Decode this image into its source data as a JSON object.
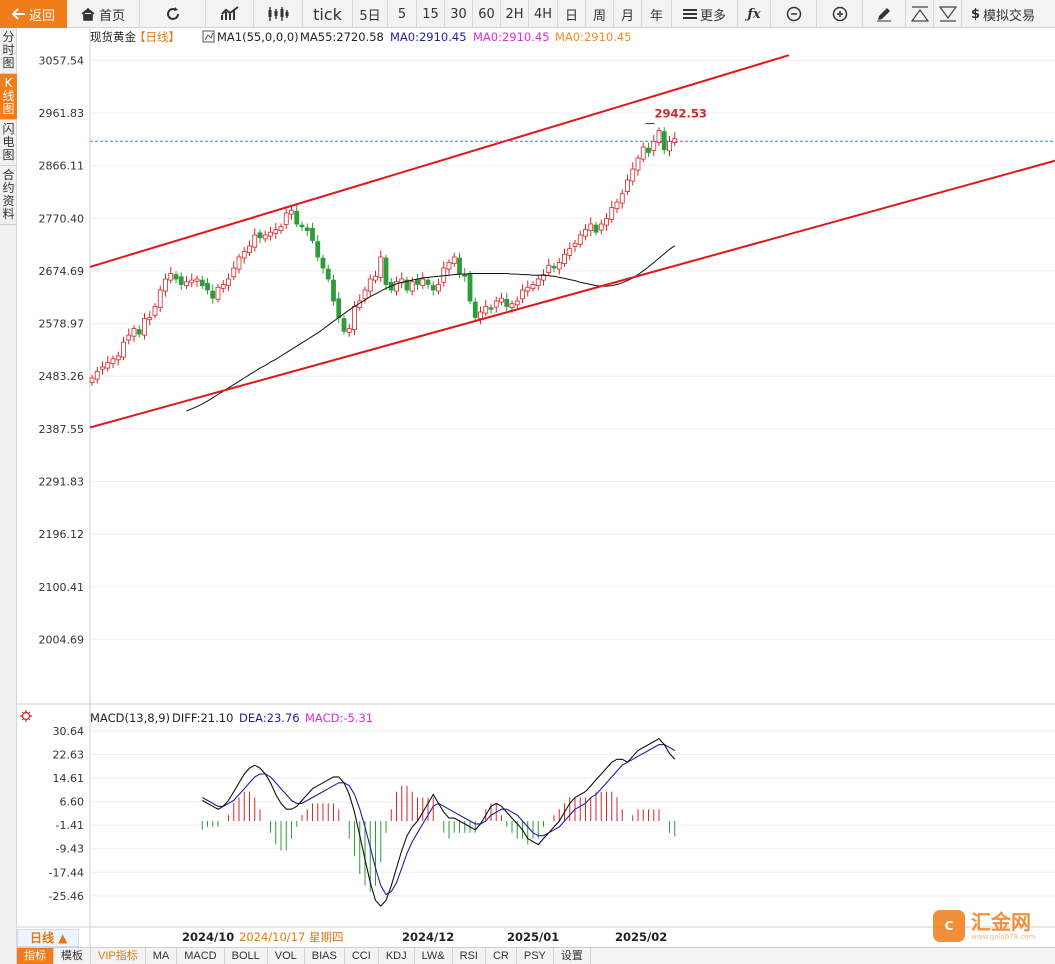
{
  "toolbar": {
    "back": "返回",
    "home": "首页",
    "tick": "tick",
    "periods": [
      "5日",
      "5",
      "15",
      "30",
      "60",
      "2H",
      "4H",
      "日",
      "周",
      "月",
      "年"
    ],
    "more": "更多",
    "simulate": "模拟交易"
  },
  "left_tabs": [
    {
      "label": "分时图",
      "active": false
    },
    {
      "label": "K线图",
      "active": true
    },
    {
      "label": "闪电图",
      "active": false
    },
    {
      "label": "合约资料",
      "active": false
    }
  ],
  "legend": {
    "symbol": "现货黄金",
    "period_tag": "【日线】",
    "ma1": "MA1(55,0,0,0)",
    "ma55": "MA55:2720.58",
    "ma_a": "MA0:2910.45",
    "ma_b": "MA0:2910.45",
    "ma_c": "MA0:2910.45",
    "high_label": "2942.53"
  },
  "macd_legend": {
    "name": "MACD(13,8,9)",
    "diff": "DIFF:21.10",
    "dea": "DEA:23.76",
    "macd": "MACD:-5.31"
  },
  "x_labels": [
    {
      "text": "2024/10",
      "highlight": false
    },
    {
      "text": "2024/10/17 星期四",
      "highlight": true
    },
    {
      "text": "2024/12",
      "highlight": false
    },
    {
      "text": "2025/01",
      "highlight": false
    },
    {
      "text": "2025/02",
      "highlight": false
    }
  ],
  "period_tab": "日线 ▲",
  "bottom_tabs": [
    "指标",
    "模板",
    "VIP指标",
    "MA",
    "MACD",
    "BOLL",
    "VOL",
    "BIAS",
    "CCI",
    "KDJ",
    "LW&",
    "RSI",
    "CR",
    "PSY",
    "设置"
  ],
  "watermark": {
    "name": "汇金网",
    "url": "www.gold678.com"
  },
  "colors": {
    "accent": "#f07c1a",
    "up": "#d62728",
    "down": "#2e9c3a",
    "channel": "#e0161b",
    "dif": "#111111",
    "dea": "#1f1f9f",
    "ma": "#111111"
  },
  "chart_data": [
    {
      "type": "candlestick",
      "title": "现货黄金 【日线】",
      "ylim": [
        1960,
        3080
      ],
      "y_ticks": [
        "3057.54",
        "2961.83",
        "2866.11",
        "2770.40",
        "2674.69",
        "2578.97",
        "2483.26",
        "2387.55",
        "2291.83",
        "2196.12",
        "2100.41",
        "2004.69"
      ],
      "last_price_line": 2910.45,
      "high_marker": 2942.53,
      "close": [
        2480,
        2492,
        2500,
        2508,
        2515,
        2520,
        2545,
        2558,
        2570,
        2560,
        2588,
        2590,
        2610,
        2640,
        2660,
        2670,
        2660,
        2650,
        2655,
        2658,
        2660,
        2648,
        2640,
        2625,
        2645,
        2650,
        2660,
        2680,
        2700,
        2710,
        2720,
        2740,
        2735,
        2740,
        2745,
        2750,
        2755,
        2780,
        2785,
        2760,
        2755,
        2748,
        2730,
        2700,
        2680,
        2660,
        2620,
        2590,
        2565,
        2570,
        2610,
        2620,
        2640,
        2660,
        2665,
        2700,
        2650,
        2640,
        2655,
        2660,
        2640,
        2655,
        2650,
        2660,
        2650,
        2640,
        2650,
        2680,
        2690,
        2700,
        2670,
        2665,
        2620,
        2590,
        2600,
        2610,
        2605,
        2620,
        2625,
        2610,
        2615,
        2620,
        2640,
        2645,
        2650,
        2660,
        2668,
        2685,
        2680,
        2690,
        2705,
        2715,
        2725,
        2740,
        2750,
        2760,
        2745,
        2760,
        2770,
        2790,
        2800,
        2815,
        2840,
        2860,
        2880,
        2900,
        2890,
        2910,
        2930,
        2895,
        2910,
        2915
      ],
      "ma55": [
        2420,
        2424,
        2428,
        2433,
        2438,
        2444,
        2450,
        2456,
        2462,
        2468,
        2474,
        2480,
        2486,
        2492,
        2498,
        2503,
        2509,
        2514,
        2520,
        2526,
        2532,
        2538,
        2544,
        2550,
        2556,
        2562,
        2569,
        2576,
        2583,
        2590,
        2597,
        2604,
        2610,
        2616,
        2622,
        2628,
        2633,
        2638,
        2643,
        2647,
        2651,
        2654,
        2656,
        2658,
        2660,
        2662,
        2663,
        2664,
        2665,
        2666,
        2667,
        2668,
        2669,
        2669,
        2670,
        2670,
        2670,
        2670,
        2670,
        2670,
        2670,
        2670,
        2669,
        2669,
        2668,
        2668,
        2667,
        2667,
        2667,
        2666,
        2665,
        2663,
        2661,
        2659,
        2657,
        2654,
        2652,
        2650,
        2648,
        2647,
        2647,
        2648,
        2650,
        2653,
        2657,
        2662,
        2668,
        2675,
        2682,
        2690,
        2698,
        2706,
        2714,
        2720.58
      ],
      "channel_upper": [
        [
          2682,
          0
        ],
        [
          3067,
          1
        ]
      ],
      "channel_lower": [
        [
          2390,
          0
        ],
        [
          2875,
          1
        ]
      ]
    },
    {
      "type": "macd",
      "title": "MACD(13,8,9)",
      "ylim": [
        -33,
        33
      ],
      "y_ticks": [
        "30.64",
        "22.63",
        "14.61",
        "6.60",
        "-1.41",
        "-9.43",
        "-17.44",
        "-25.46"
      ],
      "dif": [
        7,
        6,
        5,
        4,
        5,
        7,
        10,
        13,
        16,
        18,
        19,
        18,
        16,
        13,
        9,
        6,
        4,
        4,
        5,
        7,
        9,
        11,
        12,
        13,
        14,
        15,
        15,
        13,
        9,
        3,
        -5,
        -13,
        -21,
        -27,
        -29,
        -27,
        -22,
        -16,
        -10,
        -5,
        -2,
        0,
        3,
        6,
        9,
        6,
        3,
        1,
        1,
        0,
        -1,
        -2,
        -3,
        -1,
        2,
        5,
        6,
        5,
        3,
        1,
        -1,
        -3,
        -6,
        -7,
        -8,
        -6,
        -4,
        -2,
        0,
        3,
        6,
        8,
        9,
        10,
        12,
        14,
        16,
        18,
        20,
        21,
        21,
        20,
        22,
        24,
        25,
        26,
        27,
        28,
        26,
        23,
        21
      ],
      "dea": [
        8,
        7,
        6,
        5,
        5,
        6,
        7,
        9,
        11,
        13,
        15,
        16,
        16,
        15,
        13,
        11,
        9,
        7,
        6,
        6,
        7,
        8,
        9,
        10,
        11,
        12,
        13,
        13,
        12,
        9,
        4,
        -2,
        -9,
        -16,
        -22,
        -25,
        -24,
        -21,
        -16,
        -11,
        -7,
        -4,
        -1,
        2,
        5,
        6,
        5,
        4,
        3,
        2,
        1,
        0,
        -1,
        -1,
        0,
        2,
        3,
        4,
        4,
        3,
        2,
        0,
        -2,
        -4,
        -5,
        -5,
        -4,
        -3,
        -2,
        0,
        2,
        4,
        5,
        6,
        8,
        9,
        11,
        13,
        15,
        17,
        19,
        20,
        21,
        22,
        23,
        24,
        25,
        26,
        26,
        25,
        24
      ],
      "macd": [
        -3,
        -2,
        -2,
        -2,
        0,
        2,
        6,
        8,
        10,
        10,
        8,
        4,
        0,
        -4,
        -8,
        -10,
        -10,
        -6,
        -2,
        2,
        4,
        6,
        6,
        6,
        6,
        6,
        4,
        0,
        -6,
        -12,
        -18,
        -22,
        -24,
        -22,
        -14,
        -4,
        4,
        10,
        12,
        12,
        10,
        8,
        8,
        8,
        8,
        0,
        -4,
        -6,
        -4,
        -4,
        -4,
        -4,
        -4,
        0,
        4,
        6,
        6,
        2,
        -2,
        -4,
        -6,
        -6,
        -8,
        -6,
        -6,
        -2,
        0,
        2,
        4,
        6,
        8,
        8,
        8,
        8,
        8,
        10,
        10,
        10,
        10,
        8,
        4,
        0,
        2,
        4,
        4,
        4,
        4,
        4,
        0,
        -4,
        -5.31
      ]
    }
  ]
}
